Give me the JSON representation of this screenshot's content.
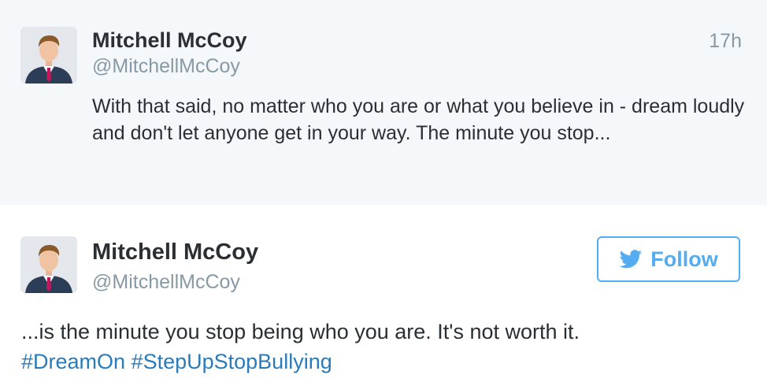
{
  "parent_tweet": {
    "display_name": "Mitchell McCoy",
    "handle": "@MitchellMcCoy",
    "time": "17h",
    "text": "With that said, no matter who you are or what you believe in - dream loudly and don't let anyone get in your way. The minute you stop..."
  },
  "main_tweet": {
    "display_name": "Mitchell McCoy",
    "handle": "@MitchellMcCoy",
    "follow_label": "Follow",
    "text": "...is the minute you stop being who you are. It's not worth it.",
    "hashtags": [
      "#DreamOn",
      "#StepUpStopBullying"
    ]
  },
  "colors": {
    "accent": "#55acee",
    "hashtag": "#2b7bb9",
    "muted": "#8899a6",
    "parent_bg": "#f5f8fa"
  },
  "icons": {
    "avatar": "user-avatar-photo",
    "follow": "twitter-bird-icon"
  }
}
